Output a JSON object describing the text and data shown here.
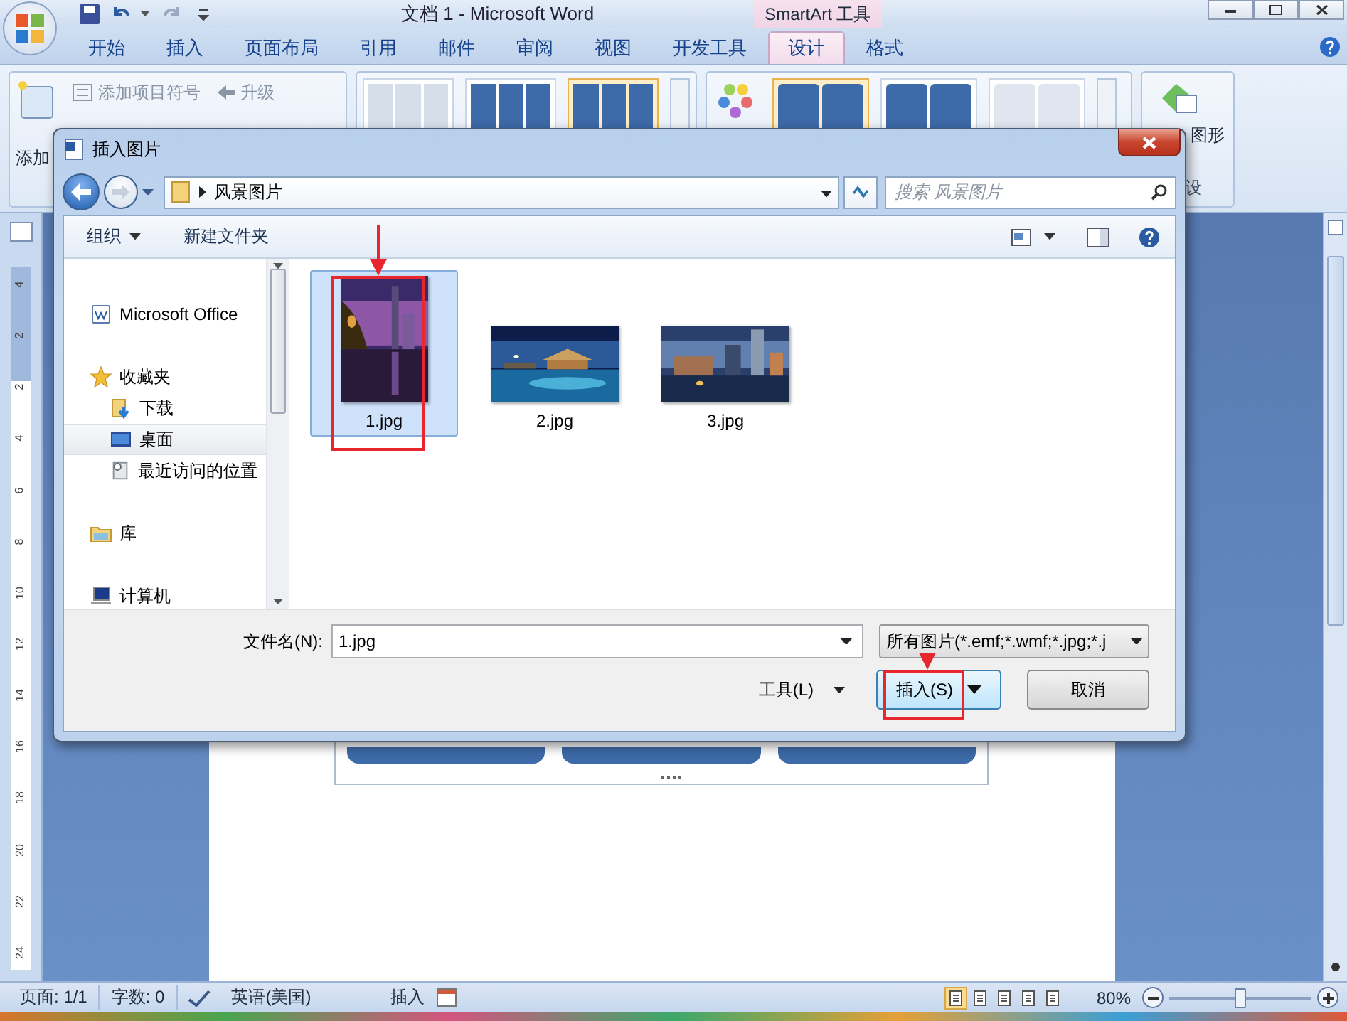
{
  "window": {
    "title": "文档 1 - Microsoft Word",
    "context_tab": "SmartArt 工具"
  },
  "tabs": [
    {
      "label": "开始",
      "selected": false
    },
    {
      "label": "插入",
      "selected": false
    },
    {
      "label": "页面布局",
      "selected": false
    },
    {
      "label": "引用",
      "selected": false
    },
    {
      "label": "邮件",
      "selected": false
    },
    {
      "label": "审阅",
      "selected": false
    },
    {
      "label": "视图",
      "selected": false
    },
    {
      "label": "开发工具",
      "selected": false
    },
    {
      "label": "设计",
      "selected": true
    },
    {
      "label": "格式",
      "selected": false
    }
  ],
  "ribbon": {
    "add_label": "添加",
    "commands": [
      "添加项目符号",
      "升级"
    ],
    "layouts": [
      {
        "selected": false
      },
      {
        "selected": false
      },
      {
        "selected": true
      }
    ],
    "styles": [
      {
        "selected": true
      },
      {
        "selected": false
      },
      {
        "selected": false
      }
    ],
    "reset_label": "图形",
    "group_label": "设"
  },
  "ruler_marks": [
    "4",
    "2",
    "2",
    "4",
    "6",
    "8",
    "10",
    "12",
    "14",
    "16",
    "18",
    "20",
    "22",
    "24"
  ],
  "dialog": {
    "title": "插入图片",
    "path": "风景图片",
    "search": {
      "placeholder": "搜索 风景图片"
    },
    "toolbar": [
      "组织",
      "新建文件夹"
    ],
    "nav": [
      {
        "label": "Microsoft Office",
        "kind": "office",
        "selected": false
      },
      {
        "label": "收藏夹",
        "kind": "favorites",
        "selected": false,
        "children": [
          {
            "label": "下载",
            "kind": "download",
            "selected": false
          },
          {
            "label": "桌面",
            "kind": "desktop",
            "selected": true
          },
          {
            "label": "最近访问的位置",
            "kind": "recent",
            "selected": false
          }
        ]
      },
      {
        "label": "库",
        "kind": "library",
        "selected": false
      },
      {
        "label": "计算机",
        "kind": "computer",
        "selected": false
      }
    ],
    "files": [
      {
        "name": "1.jpg",
        "selected": true,
        "kind": "portrait"
      },
      {
        "name": "2.jpg",
        "selected": false,
        "kind": "palace"
      },
      {
        "name": "3.jpg",
        "selected": false,
        "kind": "skyline"
      }
    ],
    "filename_label": "文件名(N):",
    "filename": "1.jpg",
    "filter": "所有图片(*.emf;*.wmf;*.jpg;*.j",
    "tools": "工具(L)",
    "insert": "插入(S)",
    "cancel": "取消"
  },
  "status_bar": {
    "page": "页面: 1/1",
    "words": "字数: 0",
    "language": "英语(美国)",
    "mode": "插入",
    "views": [
      {
        "selected": true
      },
      {
        "selected": false
      },
      {
        "selected": false
      },
      {
        "selected": false
      },
      {
        "selected": false
      }
    ],
    "zoom": "80%",
    "zoom_slider": {
      "level": 0.5
    }
  }
}
